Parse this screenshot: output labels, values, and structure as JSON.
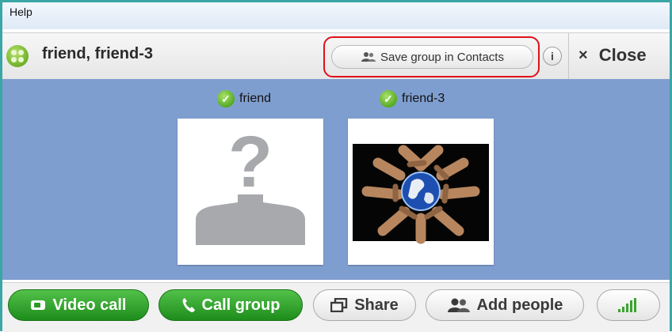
{
  "menu": {
    "help_label": "Help"
  },
  "header": {
    "title": "friend, friend-3",
    "save_group_label": "Save group in Contacts",
    "info_label": "i",
    "close_label": "Close",
    "close_icon": "×"
  },
  "participants": [
    {
      "name": "friend",
      "status": "online",
      "avatar": "unknown-avatar"
    },
    {
      "name": "friend-3",
      "status": "online",
      "avatar": "globe-hands-photo"
    }
  ],
  "toolbar": {
    "video_call_label": "Video call",
    "call_group_label": "Call group",
    "share_label": "Share",
    "add_people_label": "Add people"
  },
  "colors": {
    "accent_green": "#2ea52a",
    "stage_blue": "#7f9ed0",
    "highlight_red": "#e0101a",
    "frame_teal": "#3aa6a6"
  }
}
